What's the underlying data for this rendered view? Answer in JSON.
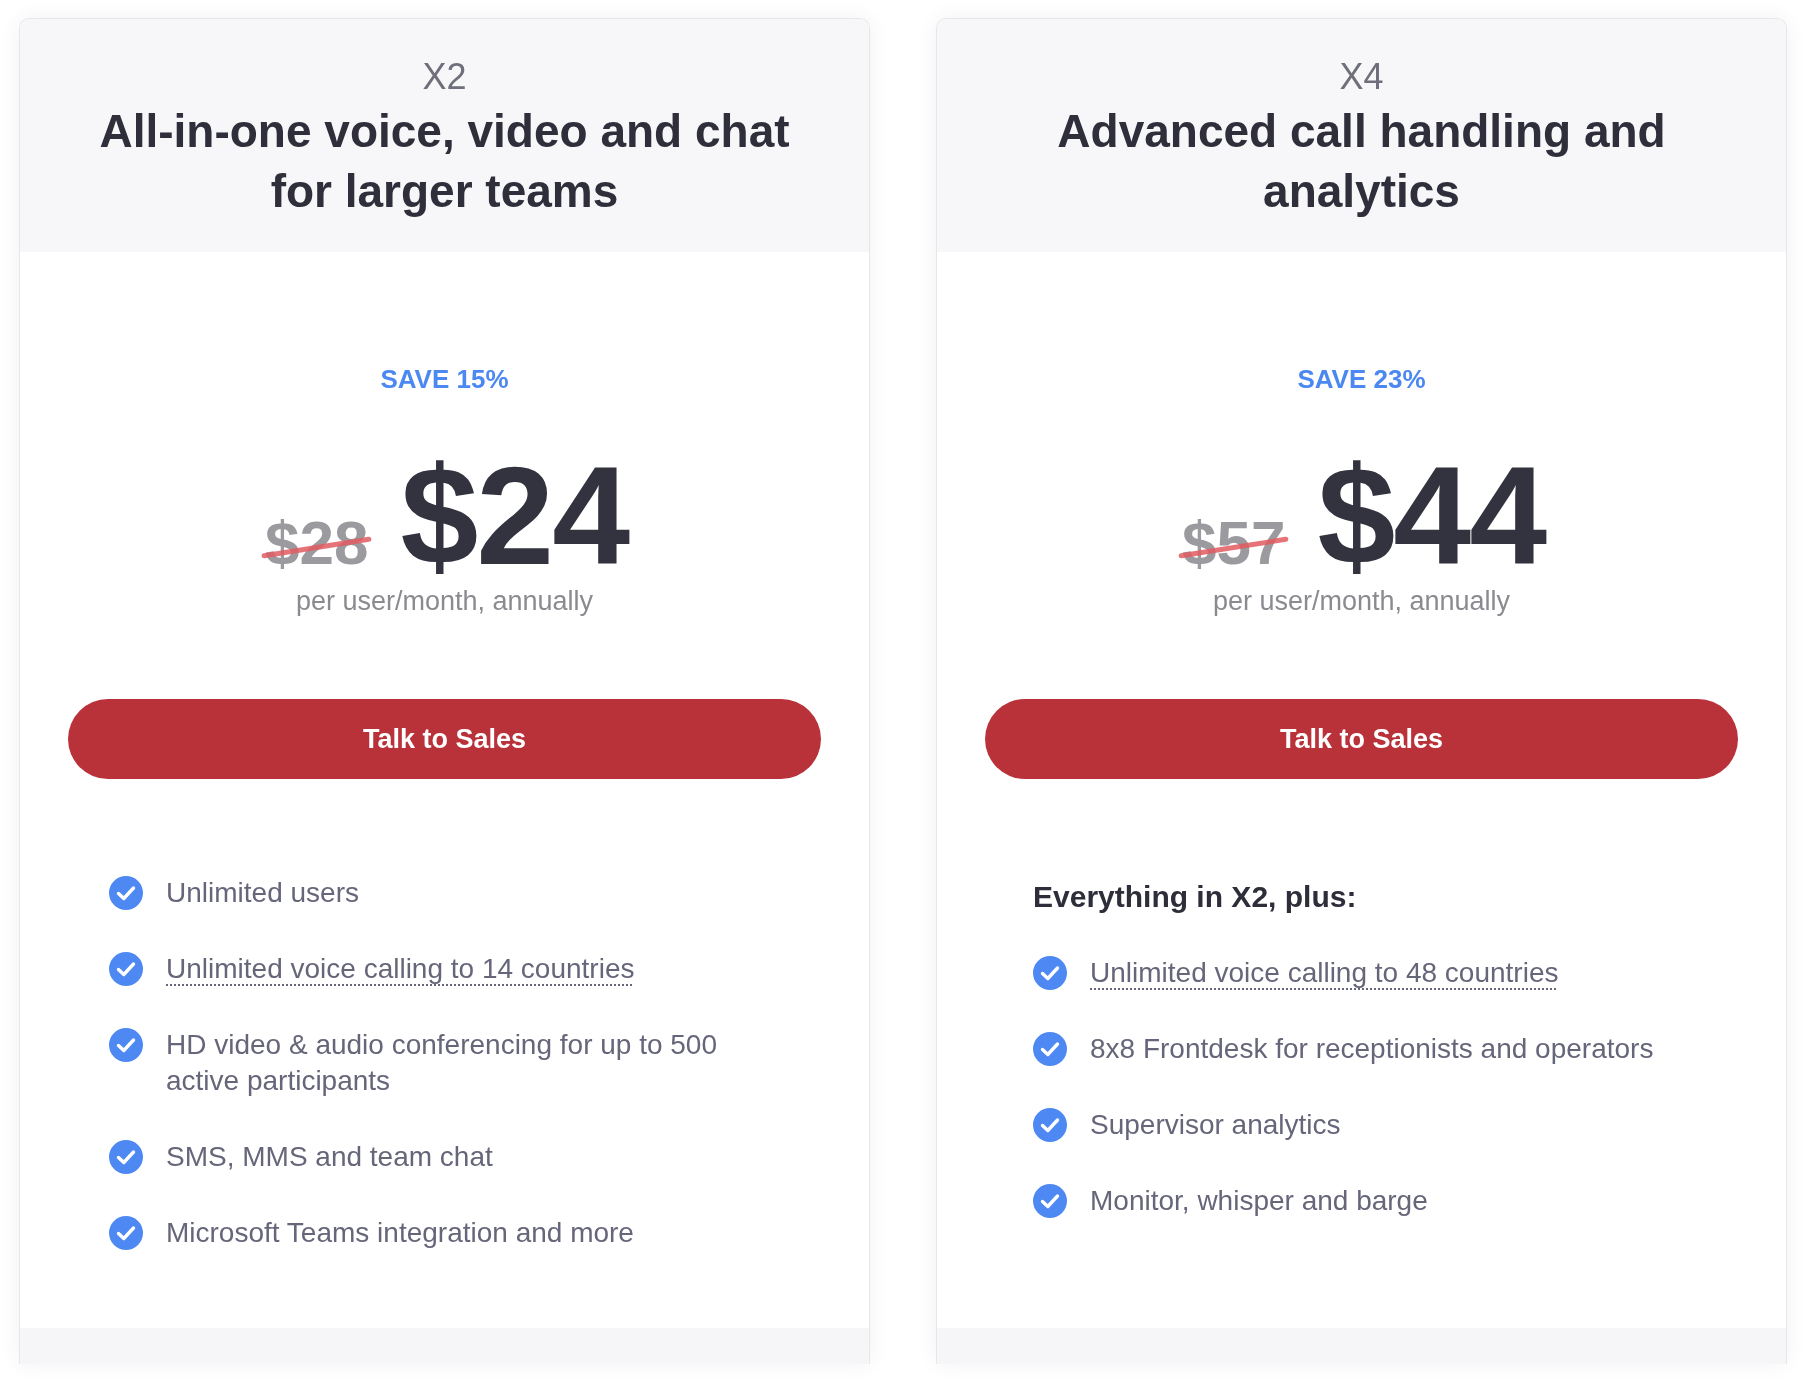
{
  "plans": [
    {
      "tier": "X2",
      "headline": "All-in-one voice, video and chat for larger teams",
      "discount": "SAVE 15%",
      "original_price": "$28",
      "price": "$24",
      "billing": "per user/month, annually",
      "cta": "Talk to Sales",
      "features": [
        {
          "text": "Unlimited users",
          "kind": "plain"
        },
        {
          "text": "Unlimited voice calling to 14 countries",
          "kind": "tooltip"
        },
        {
          "text": "HD video & audio conferencing for up to 500 active participants",
          "kind": "plain"
        },
        {
          "text": "SMS, MMS and team chat",
          "kind": "plain"
        },
        {
          "text": "Microsoft Teams integration and more",
          "kind": "plain"
        }
      ]
    },
    {
      "tier": "X4",
      "headline": "Advanced call handling and analytics",
      "discount": "SAVE 23%",
      "original_price": "$57",
      "price": "$44",
      "billing": "per user/month, annually",
      "cta": "Talk to Sales",
      "features_intro": "Everything in X2, plus:",
      "features": [
        {
          "text": "Unlimited voice calling to 48 countries",
          "kind": "tooltip"
        },
        {
          "text": "8x8 Frontdesk for receptionists and operators",
          "kind": "plain"
        },
        {
          "text": "Supervisor analytics",
          "kind": "plain"
        },
        {
          "text": "Monitor, whisper and barge",
          "kind": "plain"
        }
      ]
    }
  ]
}
